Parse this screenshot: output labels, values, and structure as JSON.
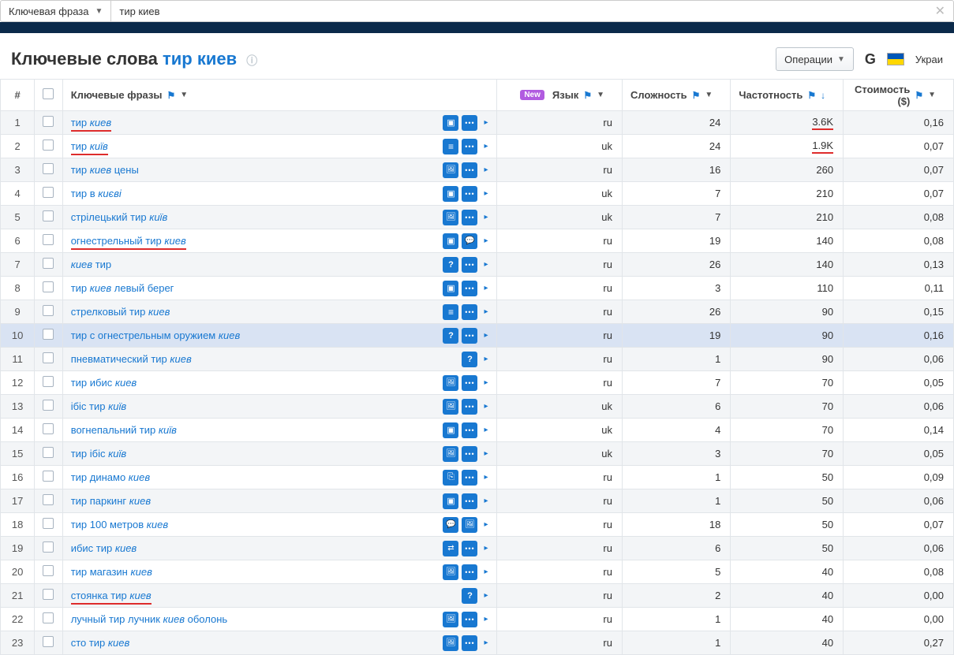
{
  "topbar": {
    "label": "Ключевая фраза",
    "value": "тир киев"
  },
  "header": {
    "title_prefix": "Ключевые слова",
    "title_keyword": "тир киев",
    "operations_label": "Операции",
    "country": "Украи"
  },
  "columns": {
    "num": "#",
    "phrases": "Ключевые фразы",
    "lang_new": "New",
    "lang": "Язык",
    "difficulty": "Сложность",
    "frequency": "Частотность",
    "cost": "Стоимость ($)"
  },
  "rows": [
    {
      "n": 1,
      "text": "тир ",
      "it": "киев",
      "under": true,
      "icons": [
        "box",
        "dots"
      ],
      "lang": "ru",
      "diff": 24,
      "freq": "3.6K",
      "freq_under": true,
      "cost": "0,16"
    },
    {
      "n": 2,
      "text": "тир ",
      "it": "київ",
      "under": true,
      "icons": [
        "menu",
        "dots"
      ],
      "lang": "uk",
      "diff": 24,
      "freq": "1.9K",
      "freq_under": true,
      "cost": "0,07"
    },
    {
      "n": 3,
      "text": "тир ",
      "it": "киев",
      "tail": " цены",
      "under": false,
      "icons": [
        "img",
        "dots"
      ],
      "lang": "ru",
      "diff": 16,
      "freq": "260",
      "cost": "0,07"
    },
    {
      "n": 4,
      "text": "тир в ",
      "it": "києві",
      "under": false,
      "icons": [
        "box",
        "dots"
      ],
      "lang": "uk",
      "diff": 7,
      "freq": "210",
      "cost": "0,07"
    },
    {
      "n": 5,
      "text": "стрілецький тир ",
      "it": "київ",
      "under": false,
      "icons": [
        "img",
        "dots"
      ],
      "lang": "uk",
      "diff": 7,
      "freq": "210",
      "cost": "0,08"
    },
    {
      "n": 6,
      "text": "огнестрельный тир ",
      "it": "киев",
      "under": true,
      "icons": [
        "box",
        "speech"
      ],
      "lang": "ru",
      "diff": 19,
      "freq": "140",
      "cost": "0,08"
    },
    {
      "n": 7,
      "text_it_first": "киев",
      "tail": " тир",
      "under": false,
      "icons": [
        "q",
        "dots"
      ],
      "lang": "ru",
      "diff": 26,
      "freq": "140",
      "cost": "0,13"
    },
    {
      "n": 8,
      "text": "тир ",
      "it": "киев",
      "tail": " левый берег",
      "under": false,
      "icons": [
        "box",
        "dots"
      ],
      "lang": "ru",
      "diff": 3,
      "freq": "110",
      "cost": "0,11"
    },
    {
      "n": 9,
      "text": "стрелковый тир ",
      "it": "киев",
      "under": false,
      "icons": [
        "menu",
        "dots"
      ],
      "lang": "ru",
      "diff": 26,
      "freq": "90",
      "cost": "0,15"
    },
    {
      "n": 10,
      "text": "тир с огнестрельным оружием ",
      "it": "киев",
      "under": false,
      "highlight": true,
      "icons": [
        "q",
        "dots"
      ],
      "lang": "ru",
      "diff": 19,
      "freq": "90",
      "cost": "0,16"
    },
    {
      "n": 11,
      "text": "пневматический тир ",
      "it": "киев",
      "under": false,
      "icons": [
        "q"
      ],
      "lang": "ru",
      "diff": 1,
      "freq": "90",
      "cost": "0,06"
    },
    {
      "n": 12,
      "text": "тир ибис ",
      "it": "киев",
      "under": false,
      "icons": [
        "img",
        "dots"
      ],
      "lang": "ru",
      "diff": 7,
      "freq": "70",
      "cost": "0,05"
    },
    {
      "n": 13,
      "text": "ібіс тир ",
      "it": "київ",
      "under": false,
      "icons": [
        "img",
        "dots"
      ],
      "lang": "uk",
      "diff": 6,
      "freq": "70",
      "cost": "0,06"
    },
    {
      "n": 14,
      "text": "вогнепальний тир ",
      "it": "київ",
      "under": false,
      "icons": [
        "box",
        "dots"
      ],
      "lang": "uk",
      "diff": 4,
      "freq": "70",
      "cost": "0,14"
    },
    {
      "n": 15,
      "text": "тир ібіс ",
      "it": "київ",
      "under": false,
      "icons": [
        "img",
        "dots"
      ],
      "lang": "uk",
      "diff": 3,
      "freq": "70",
      "cost": "0,05"
    },
    {
      "n": 16,
      "text": "тир динамо ",
      "it": "киев",
      "under": false,
      "icons": [
        "ad",
        "dots"
      ],
      "lang": "ru",
      "diff": 1,
      "freq": "50",
      "cost": "0,09"
    },
    {
      "n": 17,
      "text": "тир паркинг ",
      "it": "киев",
      "under": false,
      "icons": [
        "box",
        "dots"
      ],
      "lang": "ru",
      "diff": 1,
      "freq": "50",
      "cost": "0,06"
    },
    {
      "n": 18,
      "text": "тир 100 метров ",
      "it": "киев",
      "under": false,
      "icons": [
        "speech",
        "img"
      ],
      "lang": "ru",
      "diff": 18,
      "freq": "50",
      "cost": "0,07"
    },
    {
      "n": 19,
      "text": "ибис тир ",
      "it": "киев",
      "under": false,
      "icons": [
        "arrow",
        "dots"
      ],
      "lang": "ru",
      "diff": 6,
      "freq": "50",
      "cost": "0,06"
    },
    {
      "n": 20,
      "text": "тир магазин ",
      "it": "киев",
      "under": false,
      "icons": [
        "img",
        "dots"
      ],
      "lang": "ru",
      "diff": 5,
      "freq": "40",
      "cost": "0,08"
    },
    {
      "n": 21,
      "text": "стоянка тир ",
      "it": "киев",
      "under": true,
      "icons": [
        "q"
      ],
      "lang": "ru",
      "diff": 2,
      "freq": "40",
      "cost": "0,00"
    },
    {
      "n": 22,
      "text": "лучный тир лучник ",
      "it": "киев",
      "tail": " оболонь",
      "under": false,
      "icons": [
        "img",
        "dots"
      ],
      "lang": "ru",
      "diff": 1,
      "freq": "40",
      "cost": "0,00"
    },
    {
      "n": 23,
      "text": "сто тир ",
      "it": "киев",
      "under": false,
      "icons": [
        "img",
        "dots"
      ],
      "lang": "ru",
      "diff": 1,
      "freq": "40",
      "cost": "0,27"
    }
  ]
}
